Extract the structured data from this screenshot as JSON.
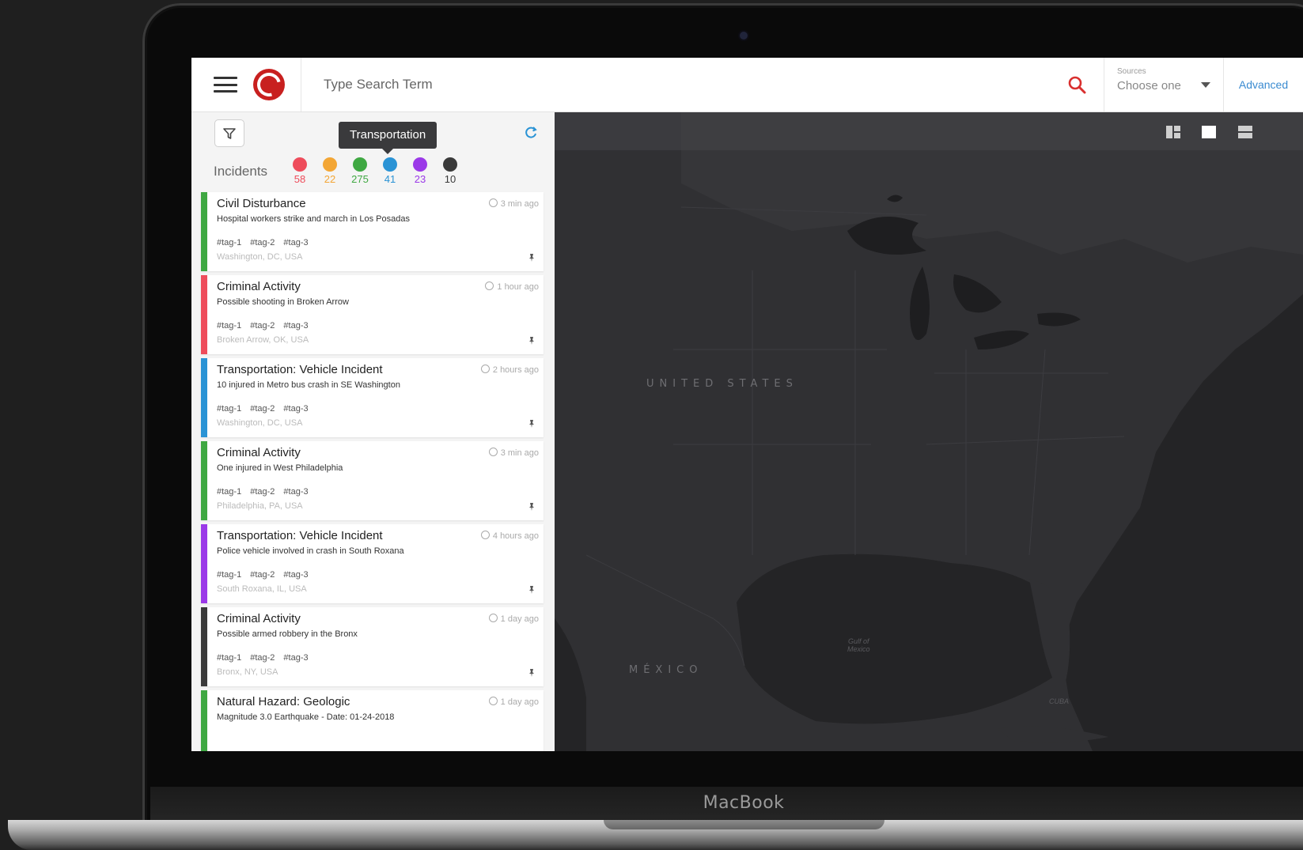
{
  "device": {
    "brand": "MacBook"
  },
  "topbar": {
    "search_placeholder": "Type Search Term",
    "sources_label": "Sources",
    "sources_value": "Choose one",
    "advanced_label": "Advanced"
  },
  "panel": {
    "tooltip": "Transportation",
    "incidents_label": "Incidents",
    "counts": [
      {
        "value": "58",
        "color": "#ee4c5b"
      },
      {
        "value": "22",
        "color": "#f3a635"
      },
      {
        "value": "275",
        "color": "#3fa842"
      },
      {
        "value": "41",
        "color": "#2a93d5"
      },
      {
        "value": "23",
        "color": "#9b39e8"
      },
      {
        "value": "10",
        "color": "#3a3a3a"
      }
    ],
    "cards": [
      {
        "title": "Civil Disturbance",
        "time": "3 min ago",
        "desc": "Hospital workers strike and march in Los Posadas",
        "tags": [
          "#tag-1",
          "#tag-2",
          "#tag-3"
        ],
        "location": "Washington, DC, USA",
        "color": "#3fa842"
      },
      {
        "title": "Criminal Activity",
        "time": "1 hour ago",
        "desc": "Possible shooting in Broken Arrow",
        "tags": [
          "#tag-1",
          "#tag-2",
          "#tag-3"
        ],
        "location": "Broken Arrow, OK, USA",
        "color": "#ee4c5b"
      },
      {
        "title": "Transportation: Vehicle Incident",
        "time": "2 hours ago",
        "desc": "10 injured in Metro bus crash in SE Washington",
        "tags": [
          "#tag-1",
          "#tag-2",
          "#tag-3"
        ],
        "location": "Washington, DC, USA",
        "color": "#2a93d5"
      },
      {
        "title": "Criminal Activity",
        "time": "3 min ago",
        "desc": "One injured in West Philadelphia",
        "tags": [
          "#tag-1",
          "#tag-2",
          "#tag-3"
        ],
        "location": "Philadelphia, PA, USA",
        "color": "#3fa842"
      },
      {
        "title": "Transportation: Vehicle Incident",
        "time": "4 hours ago",
        "desc": "Police vehicle involved in crash in South Roxana",
        "tags": [
          "#tag-1",
          "#tag-2",
          "#tag-3"
        ],
        "location": "South Roxana, IL, USA",
        "color": "#9b39e8"
      },
      {
        "title": "Criminal Activity",
        "time": "1 day ago",
        "desc": "Possible armed robbery in the Bronx",
        "tags": [
          "#tag-1",
          "#tag-2",
          "#tag-3"
        ],
        "location": "Bronx, NY, USA",
        "color": "#3a3a3a"
      },
      {
        "title": "Natural Hazard: Geologic",
        "time": "1 day ago",
        "desc": "Magnitude 3.0 Earthquake - Date: 01-24-2018",
        "tags": [],
        "location": "",
        "color": "#3fa842"
      }
    ]
  },
  "map": {
    "labels": {
      "us": "UNITED STATES",
      "mexico": "MÉXICO",
      "gulf_line1": "Gulf of",
      "gulf_line2": "Mexico",
      "cuba": "CUBA"
    }
  }
}
